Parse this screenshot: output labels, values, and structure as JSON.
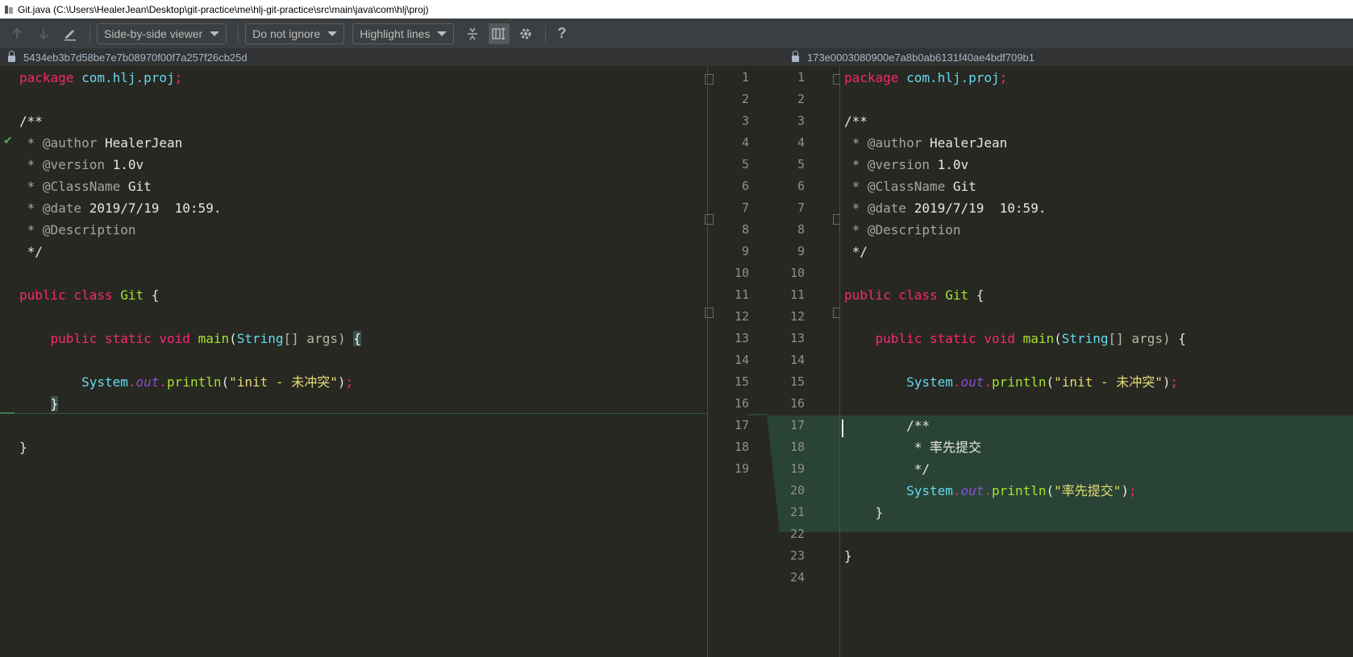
{
  "window": {
    "title": "Git.java (C:\\Users\\HealerJean\\Desktop\\git-practice\\me\\hlj-git-practice\\src\\main\\java\\com\\hlj\\proj)"
  },
  "toolbar": {
    "viewer": "Side-by-side viewer",
    "ignore": "Do not ignore",
    "highlight": "Highlight lines",
    "help": "?"
  },
  "revisions": {
    "left": "5434eb3b7d58be7e7b08970f00f7a257f26cb25d",
    "right": "173e0003080900e7a8b0ab6131f40ae4bdf709b1"
  },
  "left_line_numbers": [
    "1",
    "2",
    "3",
    "4",
    "5",
    "6",
    "7",
    "8",
    "9",
    "10",
    "11",
    "12",
    "13",
    "14",
    "15",
    "16",
    "17",
    "18",
    "19"
  ],
  "right_line_numbers": [
    "1",
    "2",
    "3",
    "4",
    "5",
    "6",
    "7",
    "8",
    "9",
    "10",
    "11",
    "12",
    "13",
    "14",
    "15",
    "16",
    "17",
    "18",
    "19",
    "20",
    "21",
    "22",
    "23",
    "24"
  ],
  "code": {
    "package_kw": "package",
    "package_name": "com.hlj.proj",
    "semicolon": ";",
    "doc_open": "/**",
    "doc_author_tag": " * @author",
    "doc_author_val": " HealerJean",
    "doc_version_tag": " * @version",
    "doc_version_val": " 1.0v",
    "doc_class_tag": " * @ClassName",
    "doc_class_val": " Git",
    "doc_date_tag": " * @date",
    "doc_date_val": " 2019/7/19  10:59.",
    "doc_desc_tag": " * @Description",
    "doc_close": " */",
    "class_kw": "public class",
    "class_name": "Git",
    "open_brace": " {",
    "main_kw": "    public static void",
    "main_fn": "main",
    "main_open": "(",
    "main_type": "String",
    "main_args": "[] args)",
    "sys": "        System",
    "dot": ".",
    "out": "out",
    "println": "println",
    "paren_open": "(",
    "str_init": "\"init - 未冲突\"",
    "paren_close_semi": ")",
    "close_method": "    }",
    "close_class": "}",
    "new_doc_open": "        /**",
    "new_doc_body": "         * 率先提交",
    "new_doc_close": "         */",
    "str_first": "\"率先提交\""
  }
}
